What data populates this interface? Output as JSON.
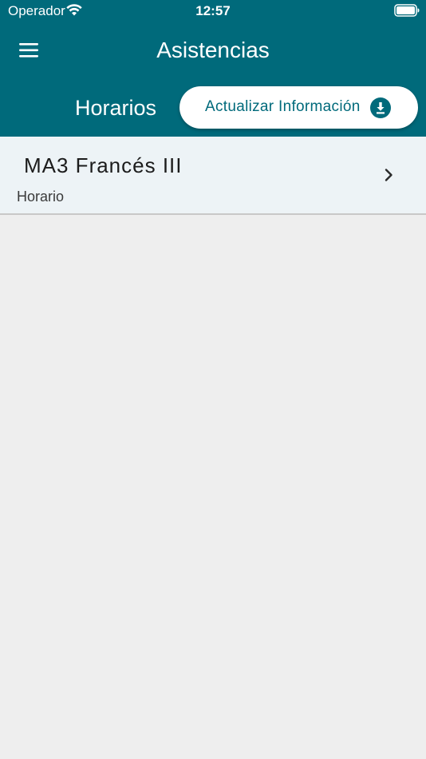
{
  "status_bar": {
    "carrier": "Operador",
    "time": "12:57"
  },
  "header": {
    "title": "Asistencias",
    "section_title": "Horarios",
    "update_button_label": "Actualizar Información"
  },
  "icons": {
    "menu": "hamburger-menu-icon",
    "wifi": "wifi-icon",
    "battery": "battery-icon",
    "download": "download-circle-icon",
    "chevron": "chevron-right-icon"
  },
  "colors": {
    "primary": "#006a7b",
    "list_background": "#edf3f6",
    "page_background": "#eeeeee"
  },
  "schedule_list": [
    {
      "title": "MA3 Francés III",
      "subtitle": "Horario"
    }
  ]
}
